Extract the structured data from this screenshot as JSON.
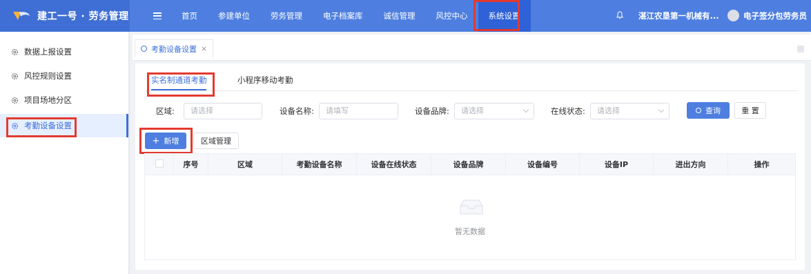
{
  "app": {
    "title": "建工一号 · 劳务管理"
  },
  "topnav": {
    "items": [
      {
        "label": "首页"
      },
      {
        "label": "参建单位"
      },
      {
        "label": "劳务管理"
      },
      {
        "label": "电子档案库"
      },
      {
        "label": "诚信管理"
      },
      {
        "label": "风控中心"
      },
      {
        "label": "系统设置",
        "active": true
      }
    ],
    "company": "湛江农垦第一机械有...",
    "user": "电子签分包劳务员"
  },
  "sidebar": {
    "items": [
      {
        "label": "数据上报设置"
      },
      {
        "label": "风控规则设置"
      },
      {
        "label": "项目场地分区"
      },
      {
        "label": "考勤设备设置",
        "active": true
      }
    ]
  },
  "tagbar": {
    "tab_label": "考勤设备设置",
    "close": "×"
  },
  "tabs": [
    {
      "label": "实名制通道考勤",
      "active": true
    },
    {
      "label": "小程序移动考勤"
    }
  ],
  "filters": {
    "region": {
      "label": "区域:",
      "placeholder": "请选择"
    },
    "device_name": {
      "label": "设备名称:",
      "placeholder": "请填写"
    },
    "brand": {
      "label": "设备品牌:",
      "placeholder": "请选择"
    },
    "online": {
      "label": "在线状态:",
      "placeholder": "请选择"
    },
    "query_label": "查询",
    "reset_label": "重 置"
  },
  "actions": {
    "add_label": "新增",
    "region_manage_label": "区域管理"
  },
  "table": {
    "columns": [
      "序号",
      "区域",
      "考勤设备名称",
      "设备在线状态",
      "设备品牌",
      "设备编号",
      "设备IP",
      "进出方向",
      "操作"
    ],
    "empty_text": "暂无数据"
  },
  "colors": {
    "primary": "#4e7fe0",
    "highlight": "#e23a2f"
  }
}
